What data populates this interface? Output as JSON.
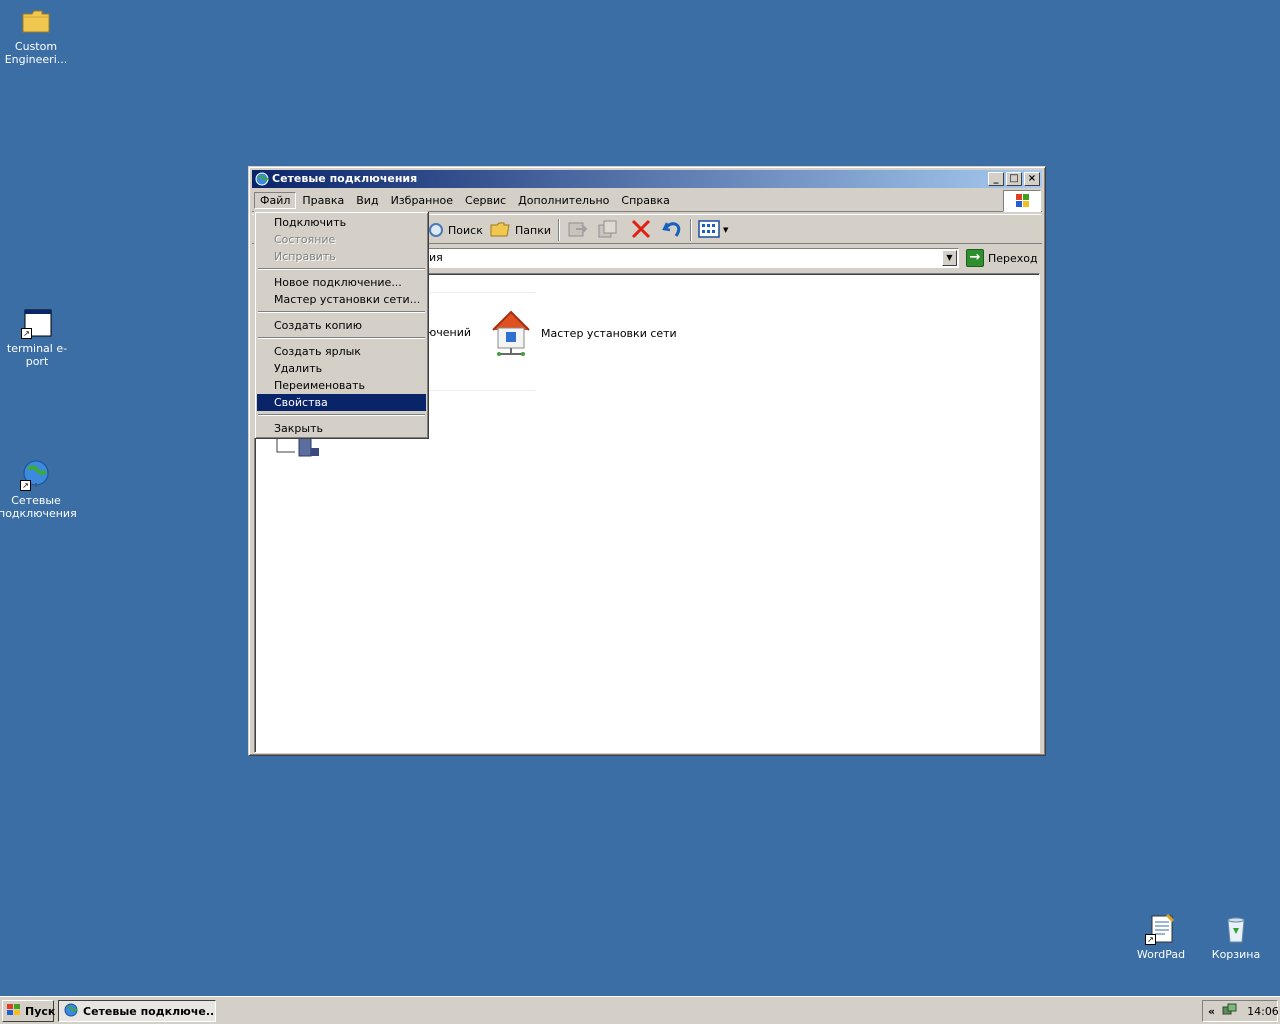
{
  "desktop": {
    "icons": [
      {
        "label": "Custom Engineeri..."
      },
      {
        "label": "terminal e-port"
      },
      {
        "label": "Сетевые подключения"
      },
      {
        "label": "WordPad"
      },
      {
        "label": "Корзина"
      }
    ]
  },
  "window": {
    "title": "Сетевые подключения",
    "menu": [
      "Файл",
      "Правка",
      "Вид",
      "Избранное",
      "Сервис",
      "Дополнительно",
      "Справка"
    ],
    "toolbar": {
      "search": "Поиск",
      "folders": "Папки"
    },
    "address": {
      "value": "ия",
      "go": "Переход"
    },
    "content": {
      "item1_partial": "ючений",
      "item2": "Мастер установки сети"
    }
  },
  "file_menu": {
    "items": [
      "Подключить",
      "Состояние",
      "Исправить",
      "Новое подключение...",
      "Мастер установки сети...",
      "Создать копию",
      "Создать ярлык",
      "Удалить",
      "Переименовать",
      "Свойства",
      "Закрыть"
    ]
  },
  "taskbar": {
    "start": "Пуск",
    "task": "Сетевые подключе...",
    "tray_chevron": "«",
    "clock": "14:06"
  },
  "colors": {
    "desktop": "#3a6ea5",
    "selection": "#0a246a",
    "face": "#d4d0c8"
  }
}
